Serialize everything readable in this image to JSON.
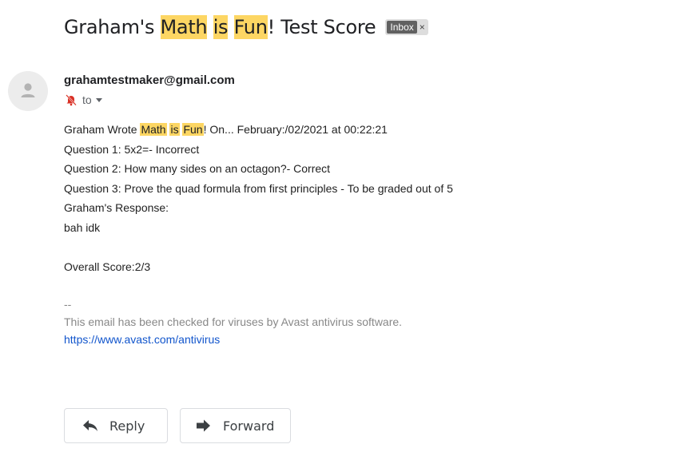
{
  "subject": {
    "prefix": "Graham's ",
    "hl1": "Math",
    "sp1": " ",
    "hl2": "is",
    "sp2": " ",
    "hl3": "Fun",
    "suffix": "! Test Score",
    "label": "Inbox",
    "label_close": "×"
  },
  "sender": {
    "email": "grahamtestmaker@gmail.com",
    "to": "to",
    "avatar_icon": "person-icon"
  },
  "body": {
    "line1": {
      "prefix": "Graham Wrote ",
      "hl1": "Math",
      "sp1": " ",
      "hl2": "is",
      "sp2": " ",
      "hl3": "Fun",
      "suffix": "! On... February:/02/2021 at 00:22:21"
    },
    "line2": "Question 1: 5x2=- Incorrect",
    "line3": "Question  2: How many sides on an octagon?- Correct",
    "line4": "Question  3: Prove the quad formula from first principles - To be graded out of 5",
    "line5": "Graham's Response:",
    "line6": "bah idk",
    "score": "Overall Score:2/3"
  },
  "signature": {
    "separator": "--",
    "note": "This email has been checked for viruses by Avast antivirus software.",
    "link": "https://www.avast.com/antivirus"
  },
  "actions": {
    "reply": "Reply",
    "forward": "Forward"
  },
  "colors": {
    "highlight": "#fdd663",
    "link": "#1155cc",
    "mute_icon": "#d93025"
  }
}
